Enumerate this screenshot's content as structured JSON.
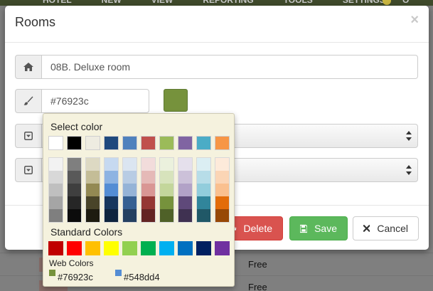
{
  "background": {
    "nav": [
      "HOTEL",
      "NEW",
      "VIEW",
      "REPORTING",
      "TOOLS",
      "SETTINGS"
    ],
    "nav_last": "O",
    "rows": [
      {
        "status": "Free"
      },
      {
        "status": "Free"
      }
    ]
  },
  "modal": {
    "title": "Rooms",
    "close_icon": "×",
    "room_name": "08B. Deluxe room",
    "color_value": "#76923c",
    "selected_color": "#76923c",
    "buttons": {
      "delete": "Delete",
      "save": "Save",
      "cancel": "Cancel"
    }
  },
  "picker": {
    "title": "Select color",
    "theme_colors": [
      "#ffffff",
      "#000000",
      "#eeece1",
      "#1f497d",
      "#4f81bd",
      "#c0504d",
      "#9bbb59",
      "#8064a2",
      "#4bacc6",
      "#f79646"
    ],
    "shades": [
      [
        "#f2f2f2",
        "#d8d8d8",
        "#bfbfbf",
        "#a5a5a5",
        "#7f7f7f"
      ],
      [
        "#7f7f7f",
        "#595959",
        "#3f3f3f",
        "#262626",
        "#0c0c0c"
      ],
      [
        "#ddd9c3",
        "#c4bd97",
        "#938953",
        "#494429",
        "#1d1b10"
      ],
      [
        "#c6d9f0",
        "#8db3e2",
        "#548dd4",
        "#17365d",
        "#0f243e"
      ],
      [
        "#dbe5f1",
        "#b8cce4",
        "#95b3d7",
        "#366092",
        "#244061"
      ],
      [
        "#f2dcdb",
        "#e5b9b7",
        "#d99694",
        "#953734",
        "#632423"
      ],
      [
        "#ebf1dd",
        "#d7e3bc",
        "#c3d69b",
        "#76923c",
        "#4f6128"
      ],
      [
        "#e5e0ec",
        "#ccc1d9",
        "#b2a2c7",
        "#5f497a",
        "#3f3151"
      ],
      [
        "#dbeef3",
        "#b7dde8",
        "#92cddc",
        "#31859b",
        "#205867"
      ],
      [
        "#fdeada",
        "#fbd5b5",
        "#fac08f",
        "#e36c09",
        "#974806"
      ]
    ],
    "standard_title": "Standard Colors",
    "standard_colors": [
      "#c00000",
      "#ff0000",
      "#ffc000",
      "#ffff00",
      "#92d050",
      "#00b050",
      "#00b0f0",
      "#0070c0",
      "#002060",
      "#7030a0"
    ],
    "web_title": "Web Colors",
    "web_colors": [
      {
        "hex": "#76923c",
        "label": "#76923c"
      },
      {
        "hex": "#548dd4",
        "label": "#548dd4"
      }
    ]
  },
  "icons": {
    "home": "home-icon",
    "brush": "paintbrush-icon",
    "dropdown": "caret-square-down-icon",
    "trash": "trash-icon",
    "save": "floppy-disk-icon",
    "cancel": "times-icon"
  }
}
